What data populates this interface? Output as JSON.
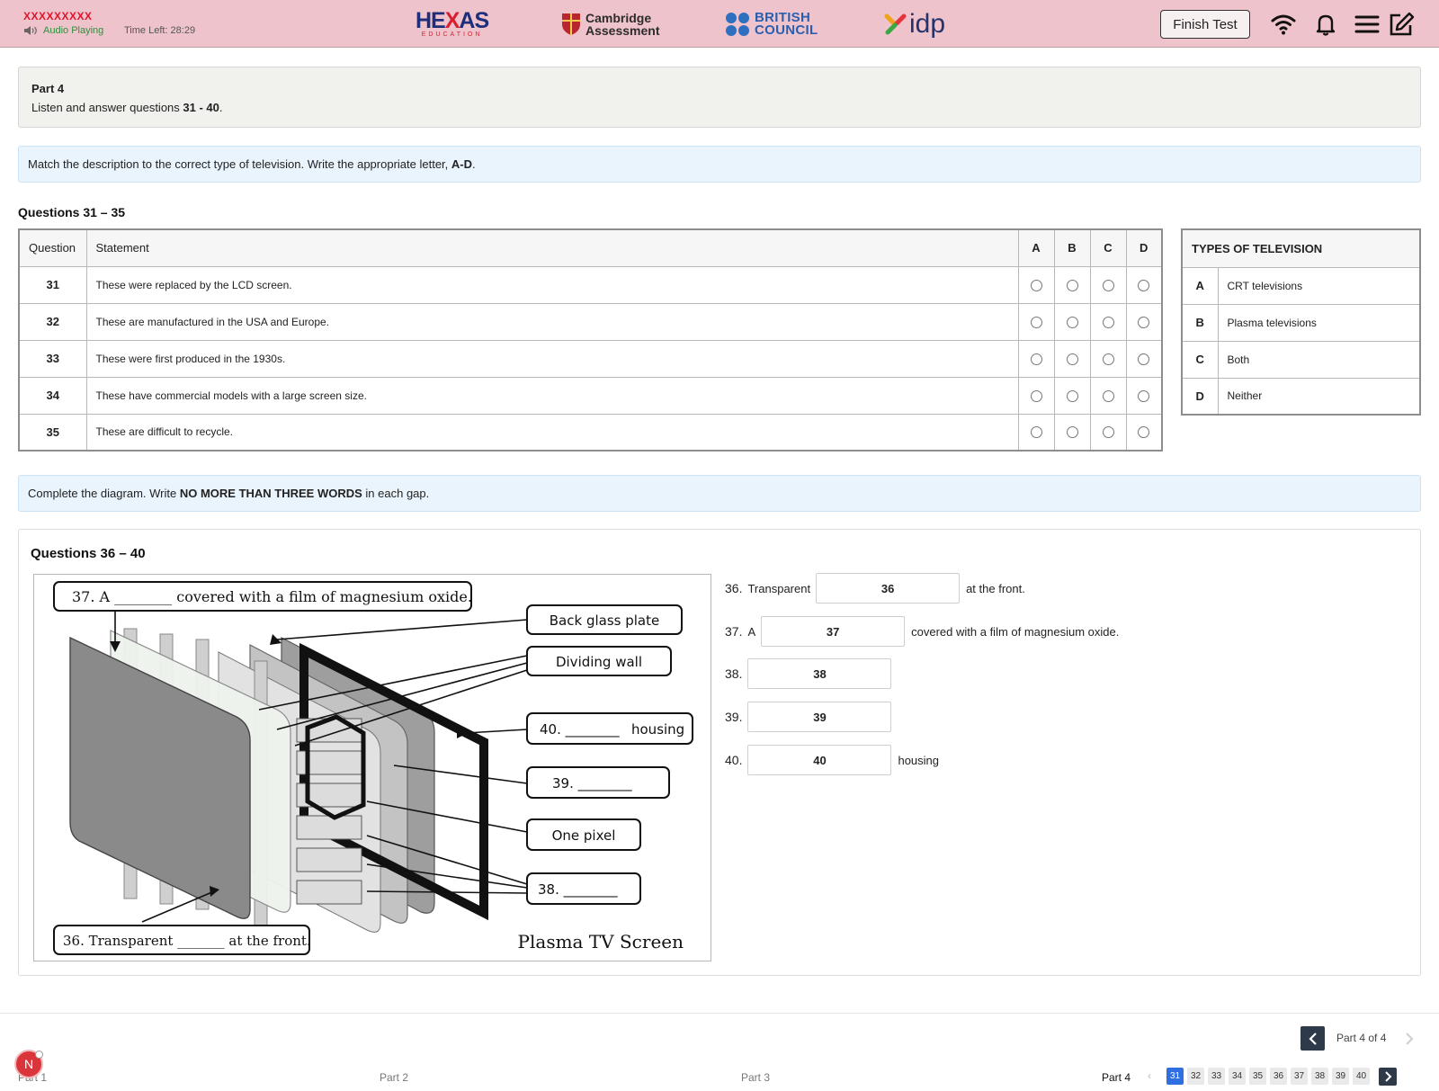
{
  "header": {
    "candidate": "XXXXXXXXX",
    "audio_status": "Audio Playing",
    "time_left": "Time Left: 28:29",
    "logos": {
      "hexas_main_a": "HE",
      "hexas_main_x": "X",
      "hexas_main_b": "AS",
      "hexas_sub": "EDUCATION",
      "cambridge_line1": "Cambridge",
      "cambridge_line2": "Assessment",
      "bc_line1": "BRITISH",
      "bc_line2": "COUNCIL",
      "idp": "idp"
    },
    "finish_label": "Finish Test",
    "icons": [
      "speaker-icon",
      "wifi-icon",
      "bell-icon",
      "menu-icon",
      "edit-icon"
    ]
  },
  "part": {
    "title": "Part 4",
    "instruction_prefix": "Listen and answer questions ",
    "instruction_range": "31 - 40",
    "instruction_suffix": "."
  },
  "match_section": {
    "instruction_prefix": "Match the description to the correct type of television. Write the appropriate letter, ",
    "instruction_bold": "A-D",
    "instruction_suffix": ".",
    "heading": "Questions 31 – 35",
    "columns": {
      "question": "Question",
      "statement": "Statement",
      "options": [
        "A",
        "B",
        "C",
        "D"
      ]
    },
    "rows": [
      {
        "number": "31",
        "statement": "These were replaced by the LCD screen."
      },
      {
        "number": "32",
        "statement": "These are manufactured in the USA and Europe."
      },
      {
        "number": "33",
        "statement": "These were first produced in the 1930s."
      },
      {
        "number": "34",
        "statement": "These have commercial models with a large screen size."
      },
      {
        "number": "35",
        "statement": "These are difficult to recycle."
      }
    ],
    "types_heading": "TYPES OF TELEVISION",
    "types": [
      {
        "letter": "A",
        "label": "CRT televisions"
      },
      {
        "letter": "B",
        "label": "Plasma televisions"
      },
      {
        "letter": "C",
        "label": "Both"
      },
      {
        "letter": "D",
        "label": "Neither"
      }
    ]
  },
  "diagram_section": {
    "instruction_prefix": "Complete the diagram. Write ",
    "instruction_bold": "NO MORE THAN THREE WORDS",
    "instruction_suffix": " in each gap.",
    "heading": "Questions 36 – 40",
    "image_labels": {
      "label_37": "37. A ________ covered with a film of magnesium oxide.",
      "back_glass": "Back glass plate",
      "dividing_wall": "Dividing wall",
      "label_40_num": "40. ________",
      "label_40_word": "housing",
      "label_39": "39. ________",
      "one_pixel": "One pixel",
      "label_38": "38. ________",
      "label_36": "36. Transparent _______ at the front.",
      "caption": "Plasma TV Screen"
    },
    "gaps": [
      {
        "num": "36.",
        "before": "Transparent",
        "value": "36",
        "after": "at the front."
      },
      {
        "num": "37.",
        "before": "A",
        "value": "37",
        "after": "covered with a film of magnesium oxide."
      },
      {
        "num": "38.",
        "before": "",
        "value": "38",
        "after": ""
      },
      {
        "num": "39.",
        "before": "",
        "value": "39",
        "after": ""
      },
      {
        "num": "40.",
        "before": "",
        "value": "40",
        "after": "housing"
      }
    ]
  },
  "footer": {
    "part_of": "Part 4 of 4",
    "parts": [
      "Part 1",
      "Part 2",
      "Part 3",
      "Part 4"
    ],
    "question_numbers": [
      "31",
      "32",
      "33",
      "34",
      "35",
      "36",
      "37",
      "38",
      "39",
      "40"
    ],
    "notification_letter": "N"
  },
  "colors": {
    "header_bg": "#efc3cb",
    "instruction_bg": "#eaf4fd",
    "part_bg": "#f1f1ee",
    "current_question": "#2f6fe0",
    "nav_button": "#2e3a49"
  }
}
